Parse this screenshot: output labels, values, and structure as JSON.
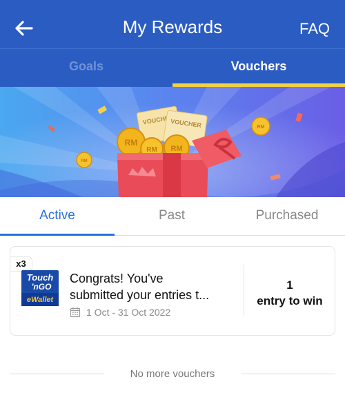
{
  "header": {
    "title": "My Rewards",
    "faq_label": "FAQ",
    "back_icon": "arrow-left-icon"
  },
  "tabs": [
    {
      "label": "Goals",
      "selected": false
    },
    {
      "label": "Vouchers",
      "selected": true
    }
  ],
  "banner": {
    "ticket_labels": [
      "VOUCHER",
      "VOUCHER"
    ],
    "coin_label": "RM"
  },
  "subtabs": [
    {
      "label": "Active",
      "selected": true
    },
    {
      "label": "Past",
      "selected": false
    },
    {
      "label": "Purchased",
      "selected": false
    }
  ],
  "voucher": {
    "quantity": "x3",
    "logo_lines": [
      "Touch",
      "'nGO",
      "eWallet"
    ],
    "title_line1": "Congrats! You've",
    "title_line2": "submitted your entries t...",
    "date_range": "1 Oct - 31 Oct 2022",
    "entry_count": "1",
    "entry_label": "entry to win"
  },
  "footer": {
    "no_more": "No more vouchers"
  },
  "colors": {
    "primary": "#2a5cc2",
    "tab_indicator": "#f4d13d",
    "active_subtab": "#2a6fdc"
  }
}
